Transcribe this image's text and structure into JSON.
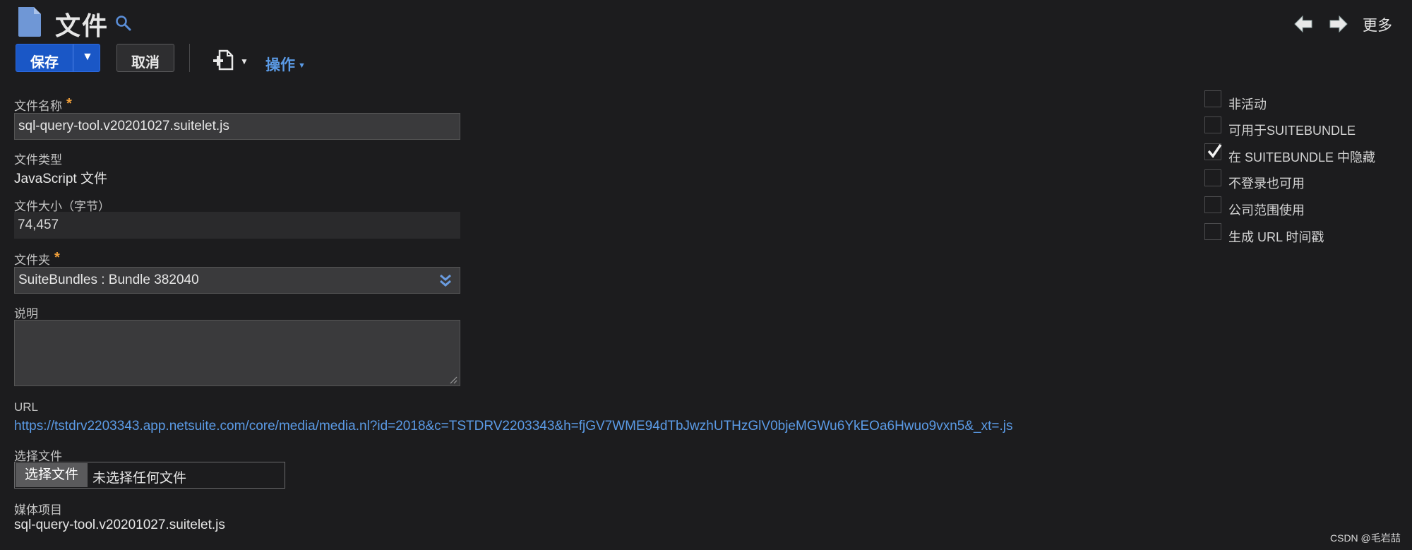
{
  "header": {
    "title": "文件",
    "more_label": "更多"
  },
  "toolbar": {
    "save_label": "保存",
    "save_caret": "▼",
    "cancel_label": "取消",
    "actions_label": "操作",
    "actions_caret": "▼",
    "newdoc_caret": "▼"
  },
  "form": {
    "file_name": {
      "label": "文件名称",
      "required_mark": "*",
      "value": "sql-query-tool.v20201027.suitelet.js"
    },
    "file_type": {
      "label": "文件类型",
      "value": "JavaScript 文件"
    },
    "file_size": {
      "label": "文件大小（字节）",
      "value": "74,457"
    },
    "folder": {
      "label": "文件夹",
      "required_mark": "*",
      "value": "SuiteBundles : Bundle 382040"
    },
    "description": {
      "label": "说明",
      "value": ""
    },
    "url": {
      "label": "URL",
      "value": "https://tstdrv2203343.app.netsuite.com/core/media/media.nl?id=2018&c=TSTDRV2203343&h=fjGV7WME94dTbJwzhUTHzGlV0bjeMGWu6YkEOa6Hwuo9vxn5&_xt=.js"
    },
    "choose_file": {
      "label": "选择文件",
      "button_label": "选择文件",
      "status": "未选择任何文件"
    },
    "media_item": {
      "label": "媒体项目",
      "value": "sql-query-tool.v20201027.suitelet.js"
    }
  },
  "checkboxes": [
    {
      "label": "非活动",
      "checked": false
    },
    {
      "label": "可用于SUITEBUNDLE",
      "checked": false
    },
    {
      "label": "在 SUITEBUNDLE 中隐藏",
      "checked": true
    },
    {
      "label": "不登录也可用",
      "checked": false
    },
    {
      "label": "公司范围使用",
      "checked": false
    },
    {
      "label": "生成 URL 时间戳",
      "checked": false
    }
  ],
  "watermark": "CSDN @毛岩喆",
  "colors": {
    "background": "#1c1c1e",
    "primary_button": "#1a57c6",
    "link": "#5b9be6",
    "required": "#f2a03a"
  },
  "icons": [
    "document-icon",
    "search-icon",
    "arrow-left-icon",
    "arrow-right-icon",
    "new-document-icon",
    "double-chevron-down-icon",
    "resize-grip-icon",
    "checkmark-icon"
  ]
}
